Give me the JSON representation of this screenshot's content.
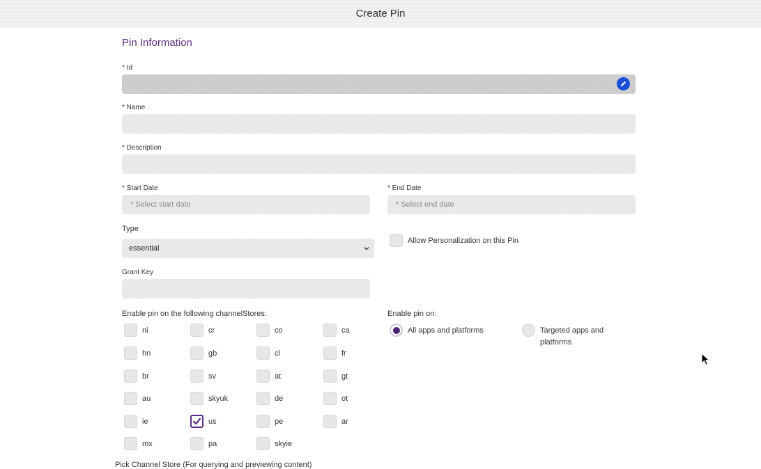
{
  "header": {
    "title": "Create Pin"
  },
  "form": {
    "section_title": "Pin Information",
    "id_label": "* Id",
    "name_label": "* Name",
    "description_label": "* Description",
    "start_date_label": "* Start Date",
    "start_date_placeholder": "* Select start date",
    "end_date_label": "* End Date",
    "end_date_placeholder": "* Select end date",
    "type_label": "Type",
    "type_value": "essential",
    "personalization_label": "Allow Personalization on this Pin",
    "personalization_checked": false,
    "grant_key_label": "Grant Key"
  },
  "channel_stores": {
    "label": "Enable pin on the following channelStores:",
    "columns": [
      [
        {
          "code": "ni",
          "checked": false
        },
        {
          "code": "hn",
          "checked": false
        },
        {
          "code": "br",
          "checked": false
        },
        {
          "code": "au",
          "checked": false
        },
        {
          "code": "ie",
          "checked": false
        },
        {
          "code": "mx",
          "checked": false
        }
      ],
      [
        {
          "code": "cr",
          "checked": false
        },
        {
          "code": "gb",
          "checked": false
        },
        {
          "code": "sv",
          "checked": false
        },
        {
          "code": "skyuk",
          "checked": false
        },
        {
          "code": "us",
          "checked": true
        },
        {
          "code": "pa",
          "checked": false
        }
      ],
      [
        {
          "code": "co",
          "checked": false
        },
        {
          "code": "cl",
          "checked": false
        },
        {
          "code": "at",
          "checked": false
        },
        {
          "code": "de",
          "checked": false
        },
        {
          "code": "pe",
          "checked": false
        },
        {
          "code": "skyie",
          "checked": false
        }
      ],
      [
        {
          "code": "ca",
          "checked": false
        },
        {
          "code": "fr",
          "checked": false
        },
        {
          "code": "gt",
          "checked": false
        },
        {
          "code": "ot",
          "checked": false
        },
        {
          "code": "ar",
          "checked": false
        }
      ]
    ]
  },
  "enable_on": {
    "label": "Enable pin on:",
    "options": [
      {
        "label": "All apps and platforms",
        "selected": true
      },
      {
        "label_line1": "Targeted apps and",
        "label_line2": "platforms",
        "selected": false
      }
    ]
  },
  "footer": {
    "pick_channel_label": "Pick Channel Store (For querying and previewing content)"
  },
  "colors": {
    "accent": "#5a2d82",
    "edit_icon": "#1a4fd6"
  },
  "icons": {
    "edit": "pencil-icon",
    "dropdown": "chevron-down-icon",
    "check": "check-icon",
    "cursor": "mouse-pointer-icon"
  }
}
